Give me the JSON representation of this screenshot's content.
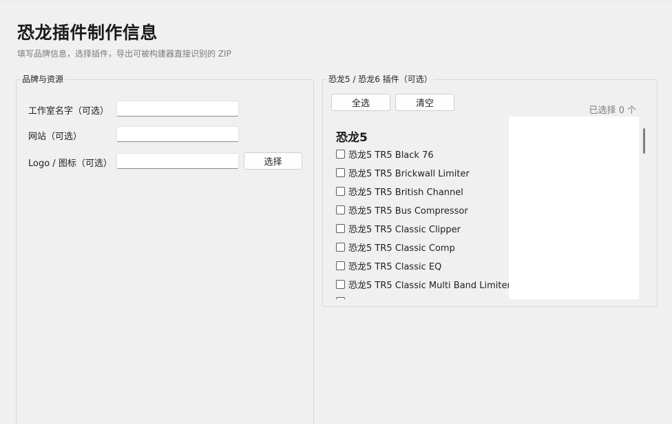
{
  "header": {
    "title": "恐龙插件制作信息",
    "subtitle": "填写品牌信息，选择插件，导出可被构建器直接识别的 ZIP"
  },
  "brand_group": {
    "legend": "品牌与资源",
    "studio_label": "工作室名字（可选）",
    "studio_value": "",
    "website_label": "网站（可选）",
    "website_value": "",
    "logo_label": "Logo / 图标（可选）",
    "logo_value": "",
    "choose_button": "选择"
  },
  "plugin_group": {
    "legend": "恐龙5 / 恐龙6 插件（可选）",
    "select_all_button": "全选",
    "clear_button": "清空",
    "selected_count": "已选择 0 个",
    "section_title": "恐龙5",
    "plugins": [
      {
        "label": "恐龙5 TR5 Black 76",
        "checked": false
      },
      {
        "label": "恐龙5 TR5 Brickwall Limiter",
        "checked": false
      },
      {
        "label": "恐龙5 TR5 British Channel",
        "checked": false
      },
      {
        "label": "恐龙5 TR5 Bus Compressor",
        "checked": false
      },
      {
        "label": "恐龙5 TR5 Classic Clipper",
        "checked": false
      },
      {
        "label": "恐龙5 TR5 Classic Comp",
        "checked": false
      },
      {
        "label": "恐龙5 TR5 Classic EQ",
        "checked": false
      },
      {
        "label": "恐龙5 TR5 Classic Multi Band Limiter",
        "checked": false
      }
    ]
  }
}
